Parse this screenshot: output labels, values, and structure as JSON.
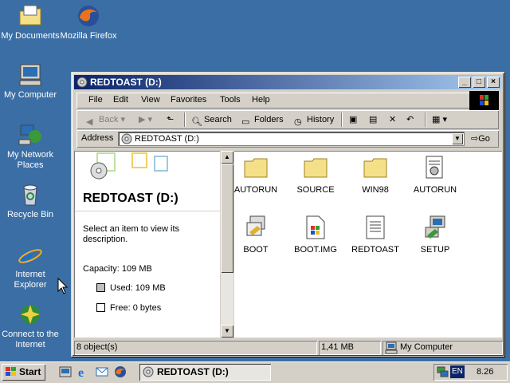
{
  "desktop": {
    "icons": [
      {
        "label": "My Documents",
        "icon": "my-documents-icon"
      },
      {
        "label": "Mozilla Firefox",
        "icon": "firefox-icon"
      },
      {
        "label": "My Computer",
        "icon": "my-computer-icon"
      },
      {
        "label": "My Network Places",
        "icon": "network-places-icon"
      },
      {
        "label": "Recycle Bin",
        "icon": "recycle-bin-icon"
      },
      {
        "label": "Internet Explorer",
        "icon": "internet-explorer-icon"
      },
      {
        "label": "Connect to the Internet",
        "icon": "connect-internet-icon"
      }
    ]
  },
  "window": {
    "title": "REDTOAST (D:)",
    "controls": {
      "minimize": "_",
      "maximize": "□",
      "close": "×"
    }
  },
  "menubar": [
    "File",
    "Edit",
    "View",
    "Favorites",
    "Tools",
    "Help"
  ],
  "toolbar": {
    "back": "Back",
    "search": "Search",
    "folders": "Folders",
    "history": "History"
  },
  "address": {
    "label": "Address",
    "value": "REDTOAST (D:)",
    "go": "Go"
  },
  "leftpane": {
    "title": "REDTOAST (D:)",
    "description": "Select an item to view its description.",
    "capacity": "Capacity: 109 MB",
    "used": "Used: 109 MB",
    "free": "Free: 0 bytes",
    "used_fraction": 1.0
  },
  "files": [
    {
      "name": "AUTORUN",
      "type": "folder"
    },
    {
      "name": "SOURCE",
      "type": "folder"
    },
    {
      "name": "WIN98",
      "type": "folder"
    },
    {
      "name": "AUTORUN",
      "type": "settings-file"
    },
    {
      "name": "BOOT",
      "type": "batch-file"
    },
    {
      "name": "BOOT.IMG",
      "type": "image-file"
    },
    {
      "name": "REDTOAST",
      "type": "text-file"
    },
    {
      "name": "SETUP",
      "type": "setup-exe"
    }
  ],
  "statusbar": {
    "objects": "8 object(s)",
    "size": "1,41 MB",
    "zone": "My Computer"
  },
  "taskbar": {
    "start": "Start",
    "task": "REDTOAST (D:)",
    "lang": "EN",
    "time": "8.26"
  },
  "colors": {
    "desktop": "#3a6ea5",
    "title_start": "#0a246a",
    "title_end": "#a6caf0",
    "face": "#d4d0c8",
    "folder": "#f5e08a"
  }
}
